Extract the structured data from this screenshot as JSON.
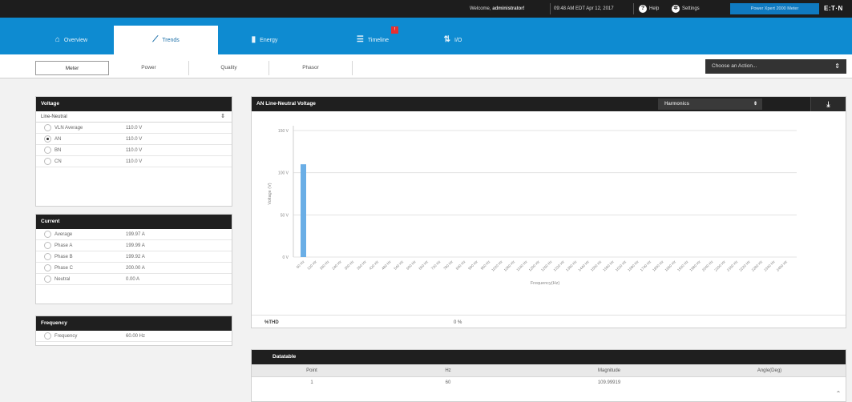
{
  "topbar": {
    "welcome_prefix": "Welcome,",
    "user": "administrator!",
    "datetime": "09:48 AM EDT Apr 12, 2017",
    "help_label": "Help",
    "settings_label": "Settings",
    "meter_label": "Power Xpert 2000 Meter",
    "logo": "E:T·N"
  },
  "nav": {
    "tabs": [
      {
        "label": "Overview",
        "icon": "home-icon",
        "glyph": "⌂"
      },
      {
        "label": "Trends",
        "icon": "trend-icon",
        "glyph": "⟋"
      },
      {
        "label": "Energy",
        "icon": "bar-icon",
        "glyph": "▮"
      },
      {
        "label": "Timeline",
        "icon": "list-icon",
        "glyph": "☰"
      },
      {
        "label": "I/O",
        "icon": "io-icon",
        "glyph": "⇅"
      }
    ],
    "timeline_badge": "!"
  },
  "subtabs": [
    "Meter",
    "Power",
    "Quality",
    "Phasor"
  ],
  "action_select": {
    "value": "Choose an Action..."
  },
  "voltage": {
    "title": "Voltage",
    "mode": "Line-Neutral",
    "rows": [
      {
        "label": "VLN Average",
        "value": "110.0 V",
        "selected": false
      },
      {
        "label": "AN",
        "value": "110.0 V",
        "selected": true
      },
      {
        "label": "BN",
        "value": "110.0 V",
        "selected": false
      },
      {
        "label": "CN",
        "value": "110.0 V",
        "selected": false
      }
    ]
  },
  "current": {
    "title": "Current",
    "rows": [
      {
        "label": "Average",
        "value": "199.97 A"
      },
      {
        "label": "Phase A",
        "value": "199.99 A"
      },
      {
        "label": "Phase B",
        "value": "199.92 A"
      },
      {
        "label": "Phase C",
        "value": "200.00 A"
      },
      {
        "label": "Neutral",
        "value": "0.00 A"
      }
    ]
  },
  "frequency": {
    "title": "Frequency",
    "rows": [
      {
        "label": "Frequency",
        "value": "60.00 Hz"
      }
    ]
  },
  "chart_panel": {
    "title": "AN Line-Neutral Voltage",
    "view_select": "Harmonics",
    "nthd_label": "%THD",
    "nthd_value": "0 %"
  },
  "chart_data": {
    "type": "bar",
    "ylabel": "Voltage (V)",
    "xlabel": "Frequency(Hz)",
    "yticks": [
      "0 V",
      "50 V",
      "100 V",
      "150 V"
    ],
    "ylim": [
      0,
      150
    ],
    "x": [
      "60 Hz",
      "120 Hz",
      "180 Hz",
      "240 Hz",
      "300 Hz",
      "360 Hz",
      "420 Hz",
      "480 Hz",
      "540 Hz",
      "600 Hz",
      "660 Hz",
      "720 Hz",
      "780 Hz",
      "840 Hz",
      "900 Hz",
      "960 Hz",
      "1020 Hz",
      "1080 Hz",
      "1140 Hz",
      "1200 Hz",
      "1260 Hz",
      "1320 Hz",
      "1380 Hz",
      "1440 Hz",
      "1500 Hz",
      "1560 Hz",
      "1620 Hz",
      "1680 Hz",
      "1740 Hz",
      "1800 Hz",
      "1860 Hz",
      "1920 Hz",
      "1980 Hz",
      "2040 Hz",
      "2100 Hz",
      "2160 Hz",
      "2220 Hz",
      "2280 Hz",
      "2340 Hz",
      "2400 Hz"
    ],
    "values": [
      110,
      0,
      0,
      0,
      0,
      0,
      0,
      0,
      0,
      0,
      0,
      0,
      0,
      0,
      0,
      0,
      0,
      0,
      0,
      0,
      0,
      0,
      0,
      0,
      0,
      0,
      0,
      0,
      0,
      0,
      0,
      0,
      0,
      0,
      0,
      0,
      0,
      0,
      0,
      0
    ],
    "color": "#6aaee6",
    "grid": true
  },
  "datatable": {
    "title": "Datatable",
    "columns": [
      "Point",
      "Hz",
      "Magnitude",
      "Angle(Deg)"
    ],
    "rows": [
      [
        "1",
        "60",
        "109.99919",
        ""
      ]
    ]
  },
  "colors": {
    "nav_bg": "#0e8bd1",
    "topbar_bg": "#1d1d1d",
    "accent": "#0f7ac0"
  }
}
